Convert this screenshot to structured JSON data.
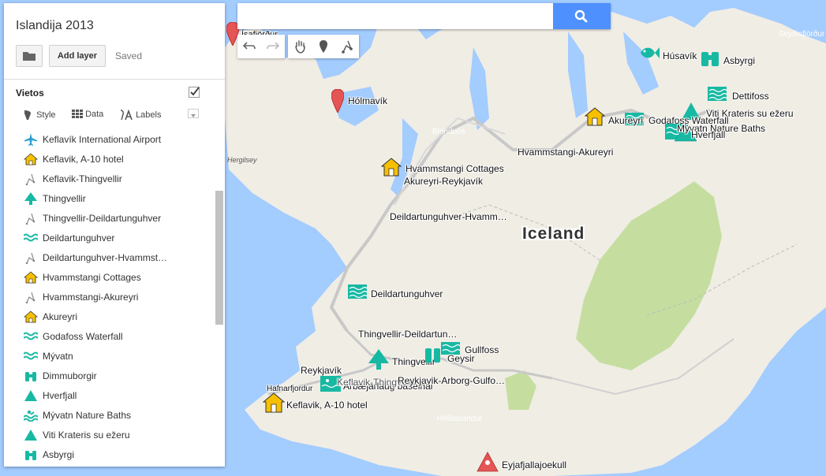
{
  "panel": {
    "map_title": "Islandija 2013",
    "add_layer_label": "Add layer",
    "saved_status": "Saved",
    "layer": {
      "name": "Vietos",
      "style_label": "Style",
      "data_label": "Data",
      "labels_label": "Labels"
    },
    "items": [
      {
        "label": "Keflavík International Airport",
        "icon": "airplane-icon",
        "color": "#2a9fd6"
      },
      {
        "label": "Keflavik, A-10 hotel",
        "icon": "house-icon",
        "color": "#f6c000"
      },
      {
        "label": "Keflavik-Thingvellir",
        "icon": "route-icon",
        "color": "#888888"
      },
      {
        "label": "Thingvellir",
        "icon": "tree-icon",
        "color": "#17b9a3"
      },
      {
        "label": "Thingvellir-Deildartunguhver",
        "icon": "route-icon",
        "color": "#888888"
      },
      {
        "label": "Deildartunguhver",
        "icon": "waves-icon",
        "color": "#17b9a3"
      },
      {
        "label": "Deildartunguhver-Hvammst…",
        "icon": "route-icon",
        "color": "#888888"
      },
      {
        "label": "Hvammstangi Cottages",
        "icon": "house-icon",
        "color": "#f6c000"
      },
      {
        "label": "Hvammstangi-Akureyri",
        "icon": "route-icon",
        "color": "#888888"
      },
      {
        "label": "Akureyri",
        "icon": "house-icon",
        "color": "#f6c000"
      },
      {
        "label": "Godafoss Waterfall",
        "icon": "waves-icon",
        "color": "#17b9a3"
      },
      {
        "label": "Mývatn",
        "icon": "waves-icon",
        "color": "#17b9a3"
      },
      {
        "label": "Dimmuborgir",
        "icon": "binoculars-icon",
        "color": "#17b9a3"
      },
      {
        "label": "Hverfjall",
        "icon": "mountain-icon",
        "color": "#17b9a3"
      },
      {
        "label": "Mývatn Nature Baths",
        "icon": "bath-icon",
        "color": "#17b9a3"
      },
      {
        "label": "Viti Krateris su ežeru",
        "icon": "mountain-icon",
        "color": "#17b9a3"
      },
      {
        "label": "Asbyrgi",
        "icon": "binoculars-icon",
        "color": "#17b9a3"
      }
    ]
  },
  "search": {
    "value": "",
    "placeholder": ""
  },
  "map": {
    "country_label": "Iceland",
    "place_labels": [
      "Ísafjörður",
      "Hólmavík",
      "Húsavík",
      "Asbyrgi",
      "Dettifoss",
      "Viti Krateris su ežeru",
      "Godafoss Waterfall",
      "Mývatn Nature Baths",
      "Hverfjall",
      "Dimmuborgir",
      "Akureyri",
      "Hvammstangi-Akureyri",
      "Hvammstangi Cottages",
      "Akureyri-Reykjavík",
      "Deildartunguhver-Hvamm…",
      "Deildartunguhver",
      "Thingvellir-Deildartun…",
      "Thingvellir",
      "Gullfoss",
      "Geysir",
      "Reykjavík",
      "Árbæjarlaug baseinai",
      "Keflavik-Thingvellir",
      "Reykjavik-Arborg-Gulfo…",
      "Hafnarfjordur",
      "Keflavik, A-10 hotel",
      "Eyjafjallajoekull"
    ],
    "small_labels": [
      "Blönduós",
      "Seyðisfjörður",
      "Höfðasandur",
      "Hergilsey"
    ],
    "colors": {
      "water": "#a3ccff",
      "land": "#f0ede5",
      "glacier_park": "#c5dea0",
      "road": "#c8c8c8",
      "marker_teal": "#17b9a3",
      "marker_yellow": "#f6c000",
      "marker_red": "#e55555"
    }
  }
}
